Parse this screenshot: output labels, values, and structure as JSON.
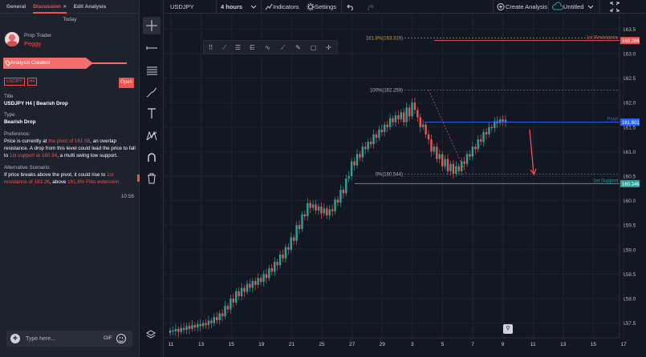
{
  "panel": {
    "tabs": [
      {
        "label": "General"
      },
      {
        "label": "Discussion",
        "close": "×"
      },
      {
        "label": "Edit Analysis"
      }
    ],
    "day_label": "Today",
    "message": {
      "role": "Prop Trader",
      "username": "Peggy",
      "banner": "Analysis Created",
      "tags": [
        "USDJPY",
        "H4"
      ],
      "open_label": "Open",
      "title_label": "Title",
      "title_value": "USDJPY H4 | Bearish Drop",
      "type_label": "Type",
      "type_value": "Bearish Drop",
      "preference_label": "Preference:",
      "preference_parts": [
        "Price is currently at ",
        "the pivot of 161.58",
        ", an overlap resistance. A drop from this level could lead the price to fall to ",
        "1st support at 160.34",
        ", a multi swing low support."
      ],
      "alternative_label": "Alternative Scenario:",
      "alternative_parts": [
        "If price breaks above the pivot, it could rise to ",
        "1st resistance of 163.26",
        ", above ",
        "161.8% Fibo extension"
      ],
      "time": "10:56"
    },
    "input": {
      "placeholder": "Type here...",
      "gif_label": "GIF"
    }
  },
  "toolbar": {
    "symbol": "USDJPY",
    "interval": "4 hours",
    "indicators_label": "Indicators",
    "settings_label": "Settings",
    "create_label": "Create Analysis",
    "layout_label": "Untitled"
  },
  "icons": {
    "tools": [
      "crosshair-icon",
      "horizontal-line-icon",
      "channel-icon",
      "brush-icon",
      "text-icon",
      "pattern-icon",
      "magnet-icon",
      "trash-icon"
    ],
    "drawing": [
      "grip-icon",
      "trendline-icon",
      "fib-icon",
      "pitchfork-icon",
      "brush-icon",
      "ray-icon",
      "pen-icon",
      "rectangle-icon",
      "crosshair-icon"
    ]
  },
  "colors": {
    "accent": "#ef5350",
    "pivot": "#2962ff",
    "support": "#26a69a",
    "resistance": "#ef5350",
    "candle_up": "#26a69a",
    "candle_down": "#ef5350"
  },
  "chart_data": {
    "type": "candlestick",
    "symbol": "USDJPY",
    "interval": "4 hours",
    "y_range": [
      157.2,
      163.8
    ],
    "y_ticks": [
      163.5,
      163,
      162.5,
      162,
      161.5,
      161,
      160.5,
      160,
      159.5,
      159,
      158.5,
      158,
      157.5
    ],
    "x_ticks": [
      "11",
      "13",
      "15",
      "19",
      "21",
      "25",
      "27",
      "29",
      "3",
      "5",
      "7",
      "9",
      "11",
      "13",
      "15",
      "17"
    ],
    "data_index_range": [
      0,
      122
    ],
    "levels": [
      {
        "label": "1st Resistance",
        "value": 163.266,
        "price_label": "163.266",
        "color": "#ef5350",
        "fib": "161.8%(163.319)",
        "fib_value": 163.319
      },
      {
        "label": "Pivot",
        "value": 161.601,
        "price_label": "161.601",
        "color": "#2962ff",
        "fib": "100%(162.259)",
        "fib_value": 162.259
      },
      {
        "label": "1st Support",
        "value": 160.346,
        "price_label": "160.346",
        "color": "#26a69a",
        "fib": "0%(160.544)",
        "fib_value": 160.544
      }
    ],
    "closes": [
      157.35,
      157.33,
      157.38,
      157.32,
      157.4,
      157.36,
      157.44,
      157.38,
      157.46,
      157.41,
      157.48,
      157.44,
      157.5,
      157.46,
      157.55,
      157.5,
      157.62,
      157.56,
      157.7,
      157.64,
      157.85,
      157.78,
      158.0,
      157.92,
      158.15,
      158.05,
      158.22,
      158.14,
      158.3,
      158.22,
      158.36,
      158.28,
      158.42,
      158.34,
      158.5,
      158.42,
      158.62,
      158.55,
      158.75,
      158.68,
      158.9,
      158.82,
      159.05,
      159.0,
      159.25,
      159.18,
      159.5,
      159.42,
      159.72,
      159.68,
      159.95,
      159.85,
      159.92,
      159.8,
      159.88,
      159.74,
      159.84,
      159.7,
      159.82,
      159.78,
      160.02,
      159.96,
      160.22,
      160.15,
      160.45,
      160.5,
      160.8,
      160.72,
      160.95,
      160.88,
      161.1,
      161.05,
      161.2,
      161.15,
      161.35,
      161.28,
      161.45,
      161.4,
      161.55,
      161.5,
      161.68,
      161.6,
      161.74,
      161.66,
      161.8,
      161.6,
      161.9,
      161.72,
      162.0,
      161.85,
      161.7,
      161.5,
      161.55,
      161.35,
      161.25,
      161.0,
      161.1,
      160.85,
      160.95,
      160.7,
      160.85,
      160.6,
      160.75,
      160.55,
      160.7,
      160.6,
      160.8,
      160.75,
      160.95,
      160.9,
      161.1,
      161.05,
      161.25,
      161.2,
      161.4,
      161.35,
      161.5,
      161.48,
      161.62,
      161.58,
      161.66,
      161.6,
      161.65
    ],
    "projection": {
      "from": 161.45,
      "to": 160.55
    }
  }
}
